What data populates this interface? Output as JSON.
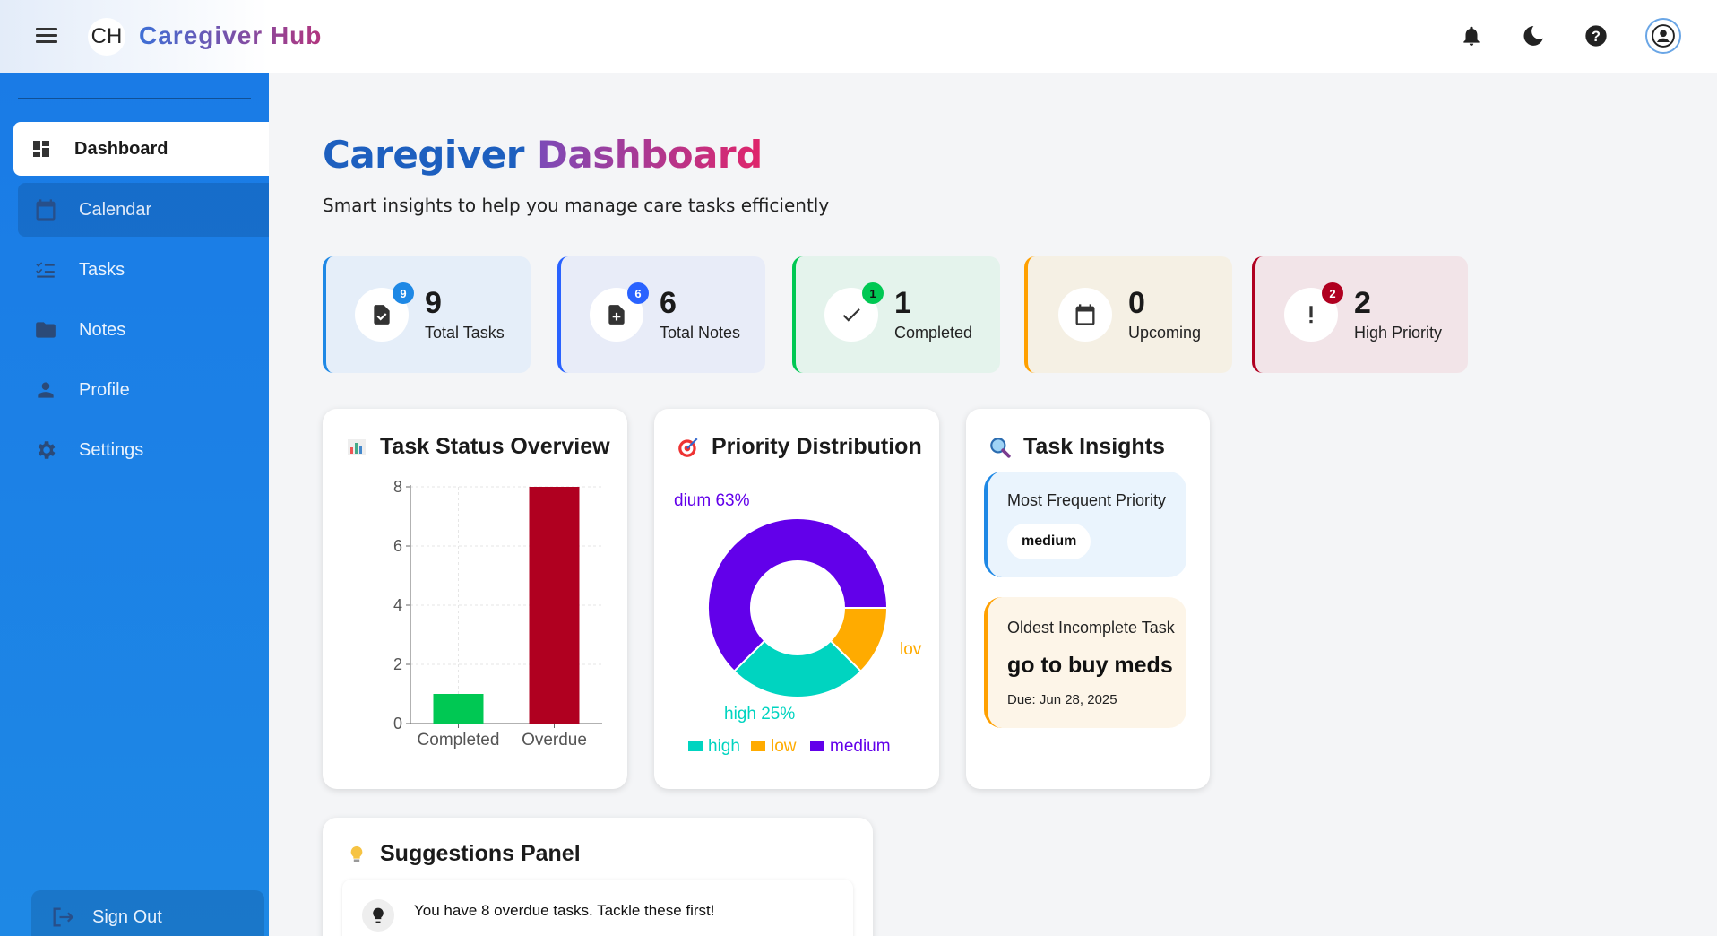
{
  "header": {
    "logo_initials": "CH",
    "app_title": "Caregiver Hub"
  },
  "sidebar": {
    "items": [
      {
        "label": "Dashboard",
        "icon": "dashboard-icon"
      },
      {
        "label": "Calendar",
        "icon": "calendar-icon"
      },
      {
        "label": "Tasks",
        "icon": "checklist-icon"
      },
      {
        "label": "Notes",
        "icon": "folder-icon"
      },
      {
        "label": "Profile",
        "icon": "person-icon"
      },
      {
        "label": "Settings",
        "icon": "gear-icon"
      }
    ],
    "sign_out": "Sign Out"
  },
  "main": {
    "title_part1": "Caregiver",
    "title_part2": "Dashboard",
    "subtitle": "Smart insights to help you manage care tasks efficiently",
    "stats": [
      {
        "value": "9",
        "label": "Total Tasks",
        "badge": "9",
        "color": "#1e88e5"
      },
      {
        "value": "6",
        "label": "Total Notes",
        "badge": "6",
        "color": "#2962ff"
      },
      {
        "value": "1",
        "label": "Completed",
        "badge": "1",
        "color": "#00c853"
      },
      {
        "value": "0",
        "label": "Upcoming",
        "badge": "",
        "color": "#ffa000"
      },
      {
        "value": "2",
        "label": "High Priority",
        "badge": "2",
        "color": "#b00020"
      }
    ]
  },
  "task_status": {
    "title": "Task Status Overview"
  },
  "priority": {
    "title": "Priority Distribution",
    "label_medium": "dium 63%",
    "label_low": "lov",
    "label_high": "high 25%",
    "legend": [
      "high",
      "low",
      "medium"
    ]
  },
  "insights": {
    "title": "Task Insights",
    "freq_heading": "Most Frequent Priority",
    "freq_value": "medium",
    "oldest_heading": "Oldest Incomplete Task",
    "oldest_task": "go to buy meds",
    "oldest_due": "Due: Jun 28, 2025"
  },
  "suggestions": {
    "title": "Suggestions Panel",
    "items": [
      "You have 8 overdue tasks. Tackle these first!"
    ]
  },
  "colors": {
    "sidebar": "#1e88e5",
    "completed": "#00c853",
    "overdue": "#b00020",
    "high": "#00d4c0",
    "low": "#ffab00",
    "medium": "#6200ea"
  },
  "chart_data": [
    {
      "type": "bar",
      "title": "Task Status Overview",
      "categories": [
        "Completed",
        "Overdue"
      ],
      "values": [
        1,
        8
      ],
      "ylim": [
        0,
        8
      ],
      "yticks": [
        0,
        2,
        4,
        6,
        8
      ],
      "colors": [
        "#00c853",
        "#b00020"
      ],
      "grid": true
    },
    {
      "type": "pie",
      "title": "Priority Distribution",
      "categories": [
        "high",
        "low",
        "medium"
      ],
      "values": [
        25,
        12.5,
        62.5
      ],
      "colors": [
        "#00d4c0",
        "#ffab00",
        "#6200ea"
      ],
      "donut": true,
      "legend": "bottom"
    }
  ]
}
